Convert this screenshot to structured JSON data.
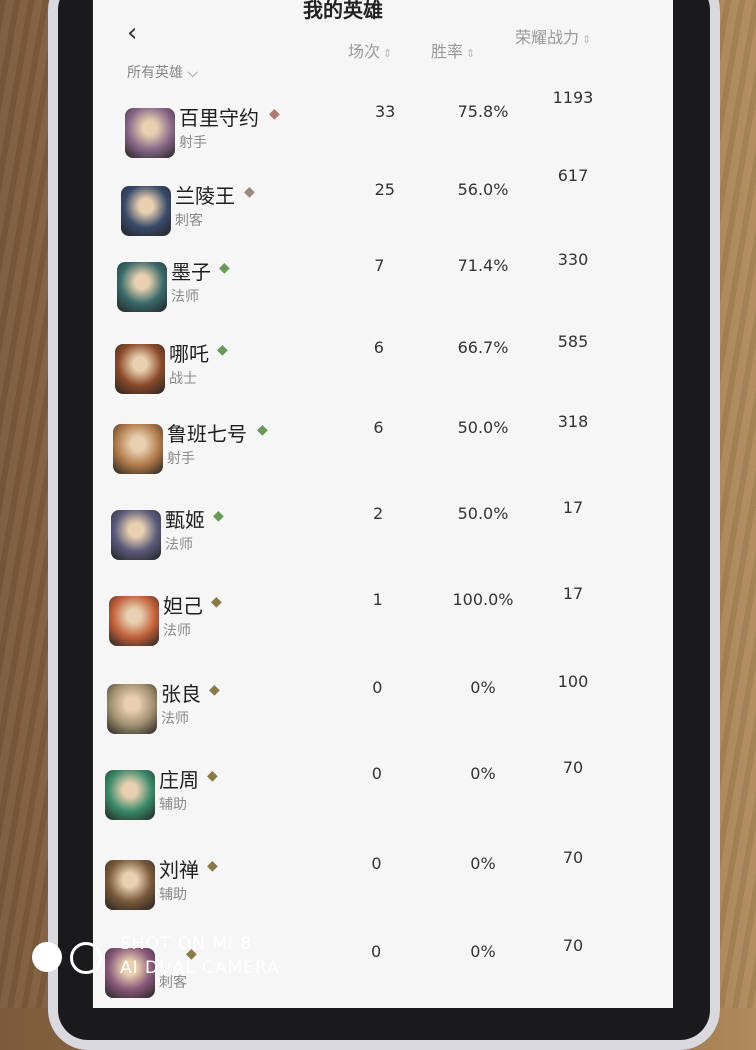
{
  "header": {
    "title": "我的英雄",
    "back_icon": "chevron-left-icon",
    "filter_label": "所有英雄"
  },
  "columns": {
    "matches": "场次",
    "winrate": "胜率",
    "power": "荣耀战力"
  },
  "heroes": [
    {
      "name": "百里守约",
      "role": "射手",
      "matches": "33",
      "winrate": "75.8%",
      "power": "1193",
      "badge_color": "#b07a72",
      "avatar_color": "#8a6a8a"
    },
    {
      "name": "兰陵王",
      "role": "刺客",
      "matches": "25",
      "winrate": "56.0%",
      "power": "617",
      "badge_color": "#9a8a7a",
      "avatar_color": "#3a4a6a"
    },
    {
      "name": "墨子",
      "role": "法师",
      "matches": "7",
      "winrate": "71.4%",
      "power": "330",
      "badge_color": "#6a9a5a",
      "avatar_color": "#3a6a6a"
    },
    {
      "name": "哪吒",
      "role": "战士",
      "matches": "6",
      "winrate": "66.7%",
      "power": "585",
      "badge_color": "#6a9a5a",
      "avatar_color": "#8a4a2a"
    },
    {
      "name": "鲁班七号",
      "role": "射手",
      "matches": "6",
      "winrate": "50.0%",
      "power": "318",
      "badge_color": "#6a9a5a",
      "avatar_color": "#b07a4a"
    },
    {
      "name": "甄姬",
      "role": "法师",
      "matches": "2",
      "winrate": "50.0%",
      "power": "17",
      "badge_color": "#6a9a5a",
      "avatar_color": "#5a5a7a"
    },
    {
      "name": "妲己",
      "role": "法师",
      "matches": "1",
      "winrate": "100.0%",
      "power": "17",
      "badge_color": "#8a7a4a",
      "avatar_color": "#c0603a"
    },
    {
      "name": "张良",
      "role": "法师",
      "matches": "0",
      "winrate": "0%",
      "power": "100",
      "badge_color": "#8a7a4a",
      "avatar_color": "#a09070"
    },
    {
      "name": "庄周",
      "role": "辅助",
      "matches": "0",
      "winrate": "0%",
      "power": "70",
      "badge_color": "#8a7a4a",
      "avatar_color": "#3a8a6a"
    },
    {
      "name": "刘禅",
      "role": "辅助",
      "matches": "0",
      "winrate": "0%",
      "power": "70",
      "badge_color": "#8a7a4a",
      "avatar_color": "#7a5a3a"
    },
    {
      "name": "",
      "role": "刺客",
      "matches": "0",
      "winrate": "0%",
      "power": "70",
      "badge_color": "#8a7a4a",
      "avatar_color": "#8a5a7a"
    }
  ],
  "watermark": {
    "line1": "SHOT ON MI 8",
    "line2": "AI DUAL CAMERA"
  }
}
